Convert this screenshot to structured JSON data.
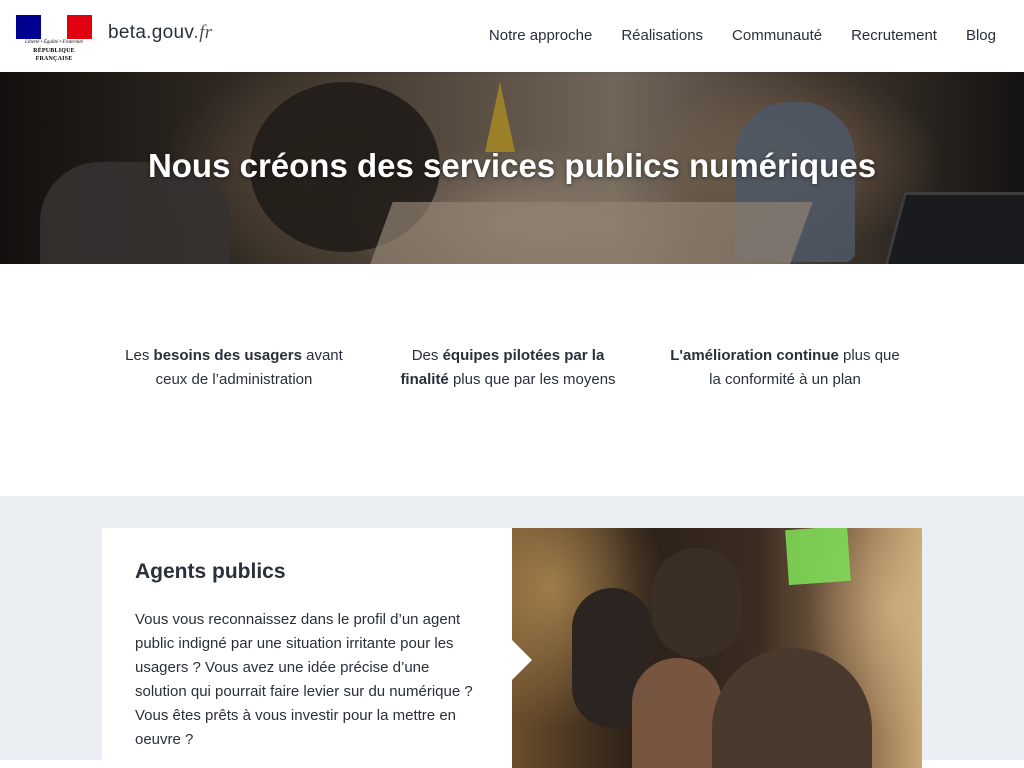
{
  "header": {
    "logo": {
      "motto": "Liberté • Égalité • Fraternité",
      "republique": "RÉPUBLIQUE FRANÇAISE"
    },
    "brand_name": "beta.gouv",
    "brand_suffix": ".fr",
    "nav": [
      {
        "label": "Notre approche"
      },
      {
        "label": "Réalisations"
      },
      {
        "label": "Communauté"
      },
      {
        "label": "Recrutement"
      },
      {
        "label": "Blog"
      }
    ]
  },
  "hero": {
    "title": "Nous créons des services publics numériques"
  },
  "values": [
    {
      "before": "Les ",
      "bold": "besoins des usagers",
      "after": " avant ceux de l’administration"
    },
    {
      "before": "Des ",
      "bold": "équipes pilotées par la finalité",
      "after": " plus que par les moyens"
    },
    {
      "before": "",
      "bold": "L'amélioration continue",
      "after": " plus que la conformité à un plan"
    }
  ],
  "agents": {
    "title": "Agents publics",
    "text": "Vous vous reconnaissez dans le profil d’un agent public indigné par une situation irritante pour les usagers ? Vous avez une idée précise d’une solution qui pourrait faire levier sur du numérique ? Vous êtes prêts à vous investir pour la mettre en oeuvre ?"
  },
  "colors": {
    "flag_blue": "#000091",
    "flag_red": "#e1000f",
    "section_bg": "#ebeff3",
    "text": "#2a2f3a"
  }
}
